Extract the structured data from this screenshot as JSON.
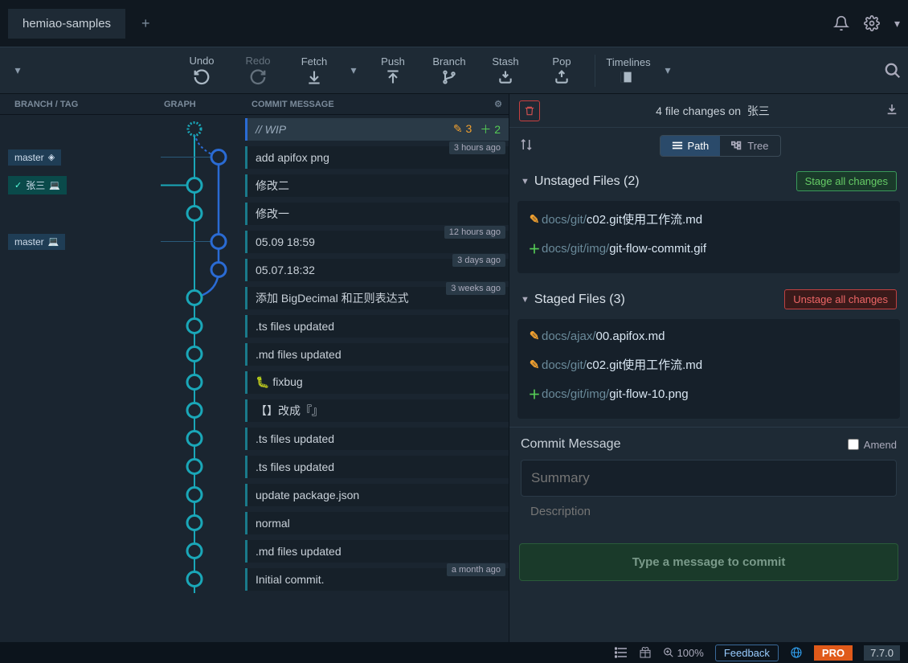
{
  "tab": {
    "title": "hemiao-samples"
  },
  "toolbar": {
    "undo": "Undo",
    "redo": "Redo",
    "fetch": "Fetch",
    "push": "Push",
    "branch": "Branch",
    "stash": "Stash",
    "pop": "Pop",
    "timelines": "Timelines"
  },
  "headers": {
    "branch": "BRANCH",
    "tag": "TAG",
    "graph": "GRAPH",
    "commit": "COMMIT MESSAGE"
  },
  "wip": {
    "label": "// WIP",
    "edited": "3",
    "added": "2"
  },
  "commits": [
    {
      "msg": "add apifox png",
      "branches": [
        {
          "name": "master",
          "remote": true
        }
      ],
      "time": "3 hours ago"
    },
    {
      "msg": "修改二",
      "branches": [
        {
          "name": "张三",
          "active": true
        }
      ]
    },
    {
      "msg": "修改一"
    },
    {
      "msg": "05.09 18:59",
      "branches": [
        {
          "name": "master"
        }
      ],
      "time": "12 hours ago"
    },
    {
      "msg": "05.07.18:32",
      "time": "3 days ago"
    },
    {
      "msg": "添加 BigDecimal 和正则表达式",
      "time": "3 weeks ago"
    },
    {
      "msg": ".ts files updated"
    },
    {
      "msg": ".md files updated"
    },
    {
      "msg": "fixbug",
      "gitmoji": true
    },
    {
      "msg": "【】改成『』"
    },
    {
      "msg": ".ts files updated"
    },
    {
      "msg": ".ts files updated"
    },
    {
      "msg": "update package.json"
    },
    {
      "msg": "normal"
    },
    {
      "msg": ".md files updated"
    },
    {
      "msg": "Initial commit.",
      "time": "a month ago"
    }
  ],
  "right": {
    "summary": "4 file changes on",
    "branch": "张三",
    "viewPath": "Path",
    "viewTree": "Tree",
    "unstaged": {
      "title": "Unstaged Files (2)",
      "action": "Stage all changes",
      "files": [
        {
          "type": "mod",
          "dir": "docs/git/",
          "name": "c02.git使用工作流.md"
        },
        {
          "type": "add",
          "dir": "docs/git/img/",
          "name": "git-flow-commit.gif"
        }
      ]
    },
    "staged": {
      "title": "Staged Files (3)",
      "action": "Unstage all changes",
      "files": [
        {
          "type": "mod",
          "dir": "docs/ajax/",
          "name": "00.apifox.md"
        },
        {
          "type": "mod",
          "dir": "docs/git/",
          "name": "c02.git使用工作流.md"
        },
        {
          "type": "add",
          "dir": "docs/git/img/",
          "name": "git-flow-10.png"
        }
      ]
    },
    "commitMsgLabel": "Commit Message",
    "amendLabel": "Amend",
    "summaryPlaceholder": "Summary",
    "descPlaceholder": "Description",
    "commitBtn": "Type a message to commit"
  },
  "status": {
    "zoom": "100%",
    "feedback": "Feedback",
    "pro": "PRO",
    "version": "7.7.0"
  }
}
